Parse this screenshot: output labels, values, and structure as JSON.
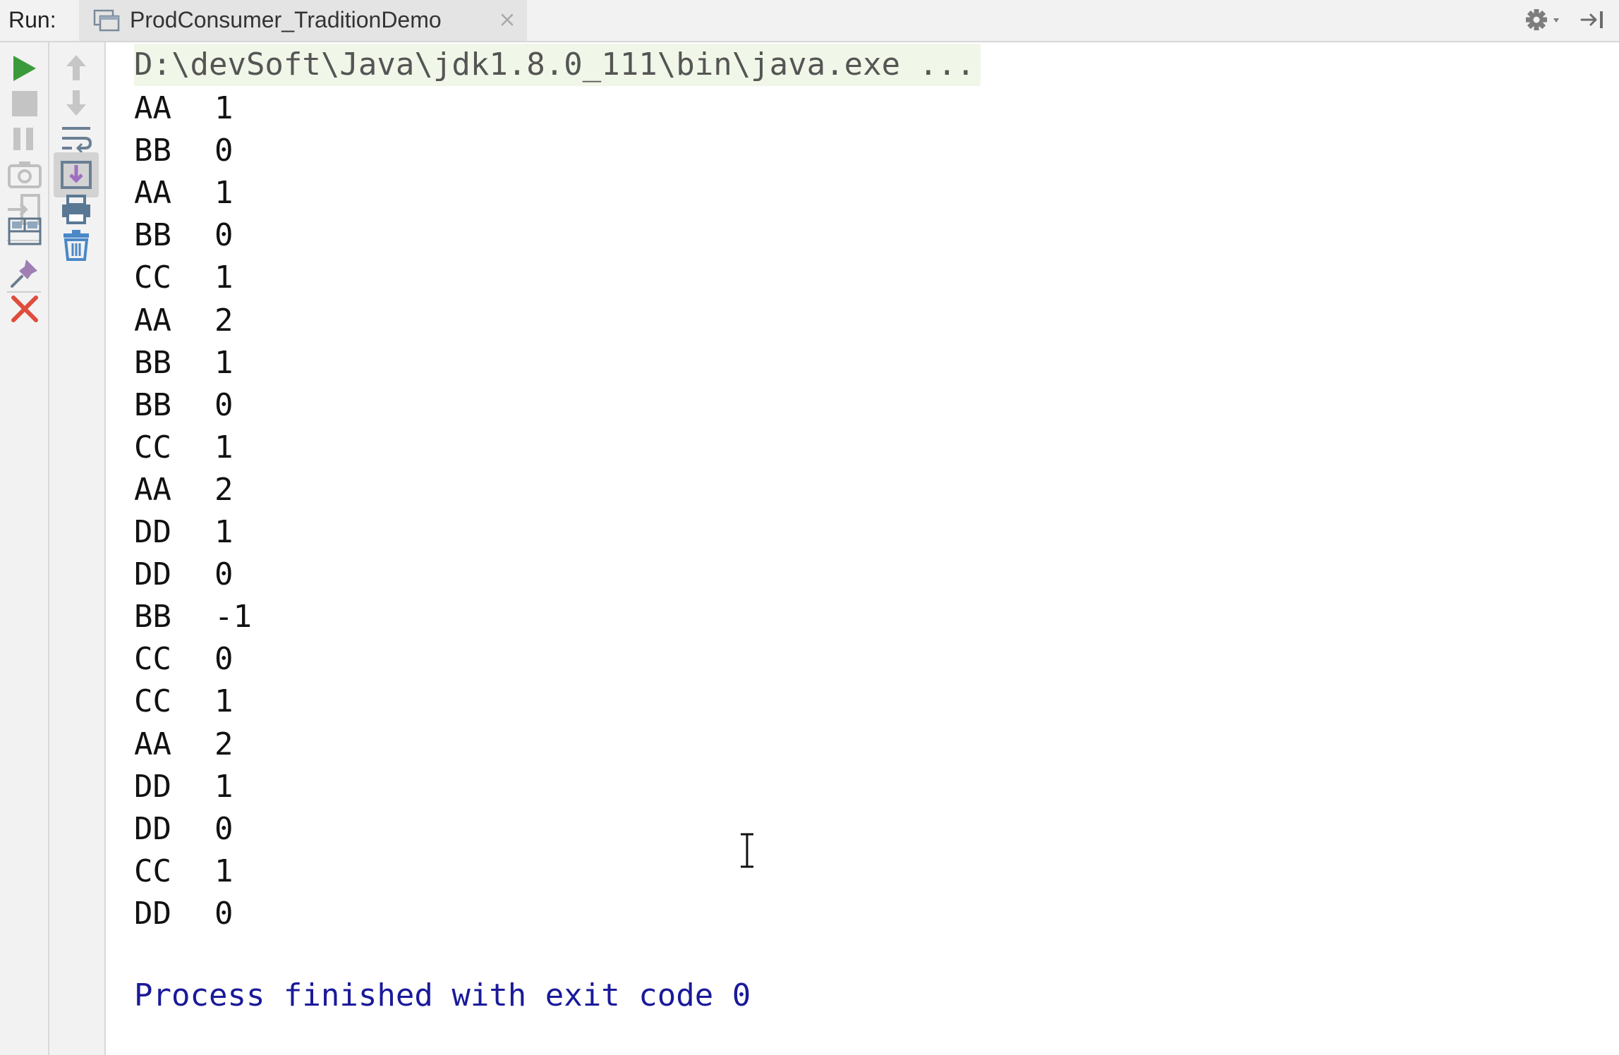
{
  "header": {
    "run_label": "Run:",
    "tab": {
      "title": "ProdConsumer_TraditionDemo",
      "icon": "run-config-icon",
      "close_icon": "close-icon"
    },
    "settings_icon": "gear-icon",
    "hide_icon": "hide-panel-icon"
  },
  "toolbar_left": {
    "buttons": [
      {
        "name": "rerun-button",
        "icon": "play-icon",
        "color": "#3b9a3b"
      },
      {
        "name": "stop-button",
        "icon": "stop-icon"
      },
      {
        "name": "pause-button",
        "icon": "pause-icon"
      },
      {
        "name": "dump-threads-button",
        "icon": "camera-icon"
      },
      {
        "name": "exit-button",
        "icon": "exit-icon"
      },
      {
        "name": "restore-layout-button",
        "icon": "layout-icon"
      },
      {
        "name": "pin-tab-button",
        "icon": "pin-icon"
      },
      {
        "name": "close-button",
        "icon": "close-red-icon",
        "color": "#e04c3c"
      }
    ]
  },
  "toolbar_right": {
    "buttons": [
      {
        "name": "up-stack-trace-button",
        "icon": "arrow-up-icon"
      },
      {
        "name": "down-stack-trace-button",
        "icon": "arrow-down-icon"
      },
      {
        "name": "soft-wrap-button",
        "icon": "soft-wrap-icon"
      },
      {
        "name": "scroll-to-end-button",
        "icon": "scroll-to-end-icon",
        "active": true
      },
      {
        "name": "print-button",
        "icon": "print-icon"
      },
      {
        "name": "clear-all-button",
        "icon": "trash-icon"
      }
    ]
  },
  "console": {
    "command": "D:\\devSoft\\Java\\jdk1.8.0_111\\bin\\java.exe ...",
    "output": [
      {
        "thread": "AA",
        "value": "1"
      },
      {
        "thread": "BB",
        "value": "0"
      },
      {
        "thread": "AA",
        "value": "1"
      },
      {
        "thread": "BB",
        "value": "0"
      },
      {
        "thread": "CC",
        "value": "1"
      },
      {
        "thread": "AA",
        "value": "2"
      },
      {
        "thread": "BB",
        "value": "1"
      },
      {
        "thread": "BB",
        "value": "0"
      },
      {
        "thread": "CC",
        "value": "1"
      },
      {
        "thread": "AA",
        "value": "2"
      },
      {
        "thread": "DD",
        "value": "1"
      },
      {
        "thread": "DD",
        "value": "0"
      },
      {
        "thread": "BB",
        "value": "-1"
      },
      {
        "thread": "CC",
        "value": "0"
      },
      {
        "thread": "CC",
        "value": "1"
      },
      {
        "thread": "AA",
        "value": "2"
      },
      {
        "thread": "DD",
        "value": "1"
      },
      {
        "thread": "DD",
        "value": "0"
      },
      {
        "thread": "CC",
        "value": "1"
      },
      {
        "thread": "DD",
        "value": "0"
      }
    ],
    "exit_message": "Process finished with exit code 0"
  },
  "colors": {
    "toolbar_bg": "#f2f2f2",
    "command_bg": "#f1f7e8",
    "exit_text": "#1a1a9a",
    "run_green": "#3b9a3b",
    "close_red": "#e04c3c"
  }
}
